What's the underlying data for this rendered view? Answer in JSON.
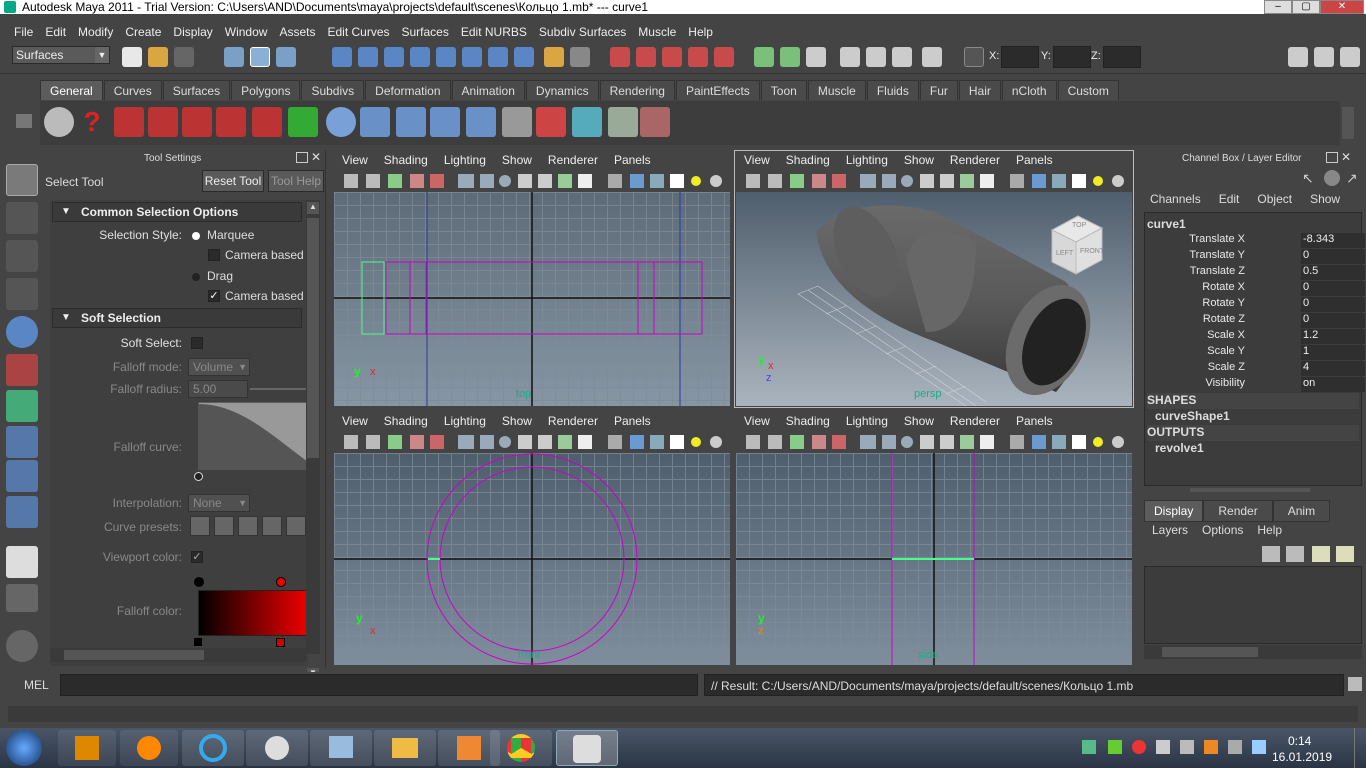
{
  "window": {
    "title": "Autodesk Maya 2011 - Trial Version: C:\\Users\\AND\\Documents\\maya\\projects\\default\\scenes\\Кольцо 1.mb*   ---   curve1"
  },
  "menubar": [
    "File",
    "Edit",
    "Modify",
    "Create",
    "Display",
    "Window",
    "Assets",
    "Edit Curves",
    "Surfaces",
    "Edit NURBS",
    "Subdiv Surfaces",
    "Muscle",
    "Help"
  ],
  "statusline": {
    "mode": "Surfaces",
    "x_label": "X:",
    "y_label": "Y:",
    "z_label": "Z:"
  },
  "shelf": {
    "tabs": [
      "General",
      "Curves",
      "Surfaces",
      "Polygons",
      "Subdivs",
      "Deformation",
      "Animation",
      "Dynamics",
      "Rendering",
      "PaintEffects",
      "Toon",
      "Muscle",
      "Fluids",
      "Fur",
      "Hair",
      "nCloth",
      "Custom"
    ],
    "active_tab": "General"
  },
  "tool_settings": {
    "header": "Tool Settings",
    "tool_name": "Select Tool",
    "reset_button": "Reset Tool",
    "help_button": "Tool Help",
    "common": {
      "title": "Common Selection Options",
      "selection_style_label": "Selection Style:",
      "marquee": "Marquee",
      "camera_based_1": "Camera based se",
      "drag": "Drag",
      "camera_based_2": "Camera based pa"
    },
    "soft": {
      "title": "Soft Selection",
      "soft_select_label": "Soft Select:",
      "falloff_mode_label": "Falloff mode:",
      "falloff_mode_value": "Volume",
      "falloff_radius_label": "Falloff radius:",
      "falloff_radius_value": "5.00",
      "falloff_curve_label": "Falloff curve:",
      "interpolation_label": "Interpolation:",
      "interpolation_value": "None",
      "curve_presets_label": "Curve presets:",
      "viewport_color_label": "Viewport color:",
      "falloff_color_label": "Falloff color:"
    }
  },
  "viewport": {
    "menu": [
      "View",
      "Shading",
      "Lighting",
      "Show",
      "Renderer",
      "Panels"
    ],
    "labels": {
      "top": "top",
      "persp": "persp",
      "front": "front",
      "side": "side"
    },
    "cube_labels": {
      "top": "TOP",
      "left": "LEFT",
      "front": "FRONT"
    }
  },
  "channel_box": {
    "header": "Channel Box / Layer Editor",
    "menu": [
      "Channels",
      "Edit",
      "Object",
      "Show"
    ],
    "object": "curve1",
    "attrs": [
      {
        "name": "Translate X",
        "value": "-8.343"
      },
      {
        "name": "Translate Y",
        "value": "0"
      },
      {
        "name": "Translate Z",
        "value": "0.5"
      },
      {
        "name": "Rotate X",
        "value": "0"
      },
      {
        "name": "Rotate Y",
        "value": "0"
      },
      {
        "name": "Rotate Z",
        "value": "0"
      },
      {
        "name": "Scale X",
        "value": "1.2"
      },
      {
        "name": "Scale Y",
        "value": "1"
      },
      {
        "name": "Scale Z",
        "value": "4"
      },
      {
        "name": "Visibility",
        "value": "on"
      }
    ],
    "shapes_label": "SHAPES",
    "shape": "curveShape1",
    "outputs_label": "OUTPUTS",
    "output": "revolve1"
  },
  "layer_editor": {
    "tabs": [
      "Display",
      "Render",
      "Anim"
    ],
    "active_tab": "Display",
    "menu": [
      "Layers",
      "Options",
      "Help"
    ]
  },
  "command_line": {
    "mel_label": "MEL",
    "result": "// Result: C:/Users/AND/Documents/maya/projects/default/scenes/Кольцо 1.mb"
  },
  "taskbar": {
    "time": "0:14",
    "date": "16.01.2019"
  },
  "colors": {
    "accent": "#c0c",
    "bg": "#444444",
    "panel": "#3a3a3a"
  }
}
